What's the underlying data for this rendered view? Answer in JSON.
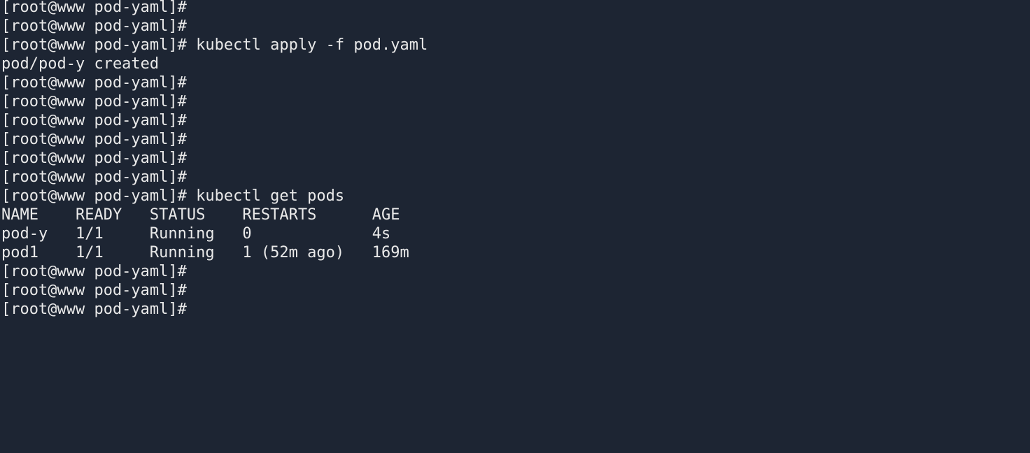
{
  "terminal": {
    "background_color": "#1d2533",
    "foreground_color": "#e9e9e9",
    "prompt": "[root@www pod-yaml]#",
    "columns_hint": 88,
    "rows_visible": 24,
    "cursor_visible": false,
    "lines": [
      "[root@www pod-yaml]#",
      "[root@www pod-yaml]#",
      "[root@www pod-yaml]# kubectl apply -f pod.yaml",
      "pod/pod-y created",
      "[root@www pod-yaml]#",
      "[root@www pod-yaml]#",
      "[root@www pod-yaml]#",
      "[root@www pod-yaml]#",
      "[root@www pod-yaml]#",
      "[root@www pod-yaml]#",
      "[root@www pod-yaml]# kubectl get pods",
      "NAME    READY   STATUS    RESTARTS      AGE",
      "pod-y   1/1     Running   0             4s",
      "pod1    1/1     Running   1 (52m ago)   169m",
      "[root@www pod-yaml]#",
      "[root@www pod-yaml]#",
      "[root@www pod-yaml]#"
    ],
    "commands": [
      "kubectl apply -f pod.yaml",
      "kubectl get pods"
    ],
    "command_output": {
      "apply_result": "pod/pod-y created",
      "pods_table": {
        "headers": [
          "NAME",
          "READY",
          "STATUS",
          "RESTARTS",
          "AGE"
        ],
        "rows": [
          [
            "pod-y",
            "1/1",
            "Running",
            "0",
            "4s"
          ],
          [
            "pod1",
            "1/1",
            "Running",
            "1 (52m ago)",
            "169m"
          ]
        ]
      }
    }
  }
}
